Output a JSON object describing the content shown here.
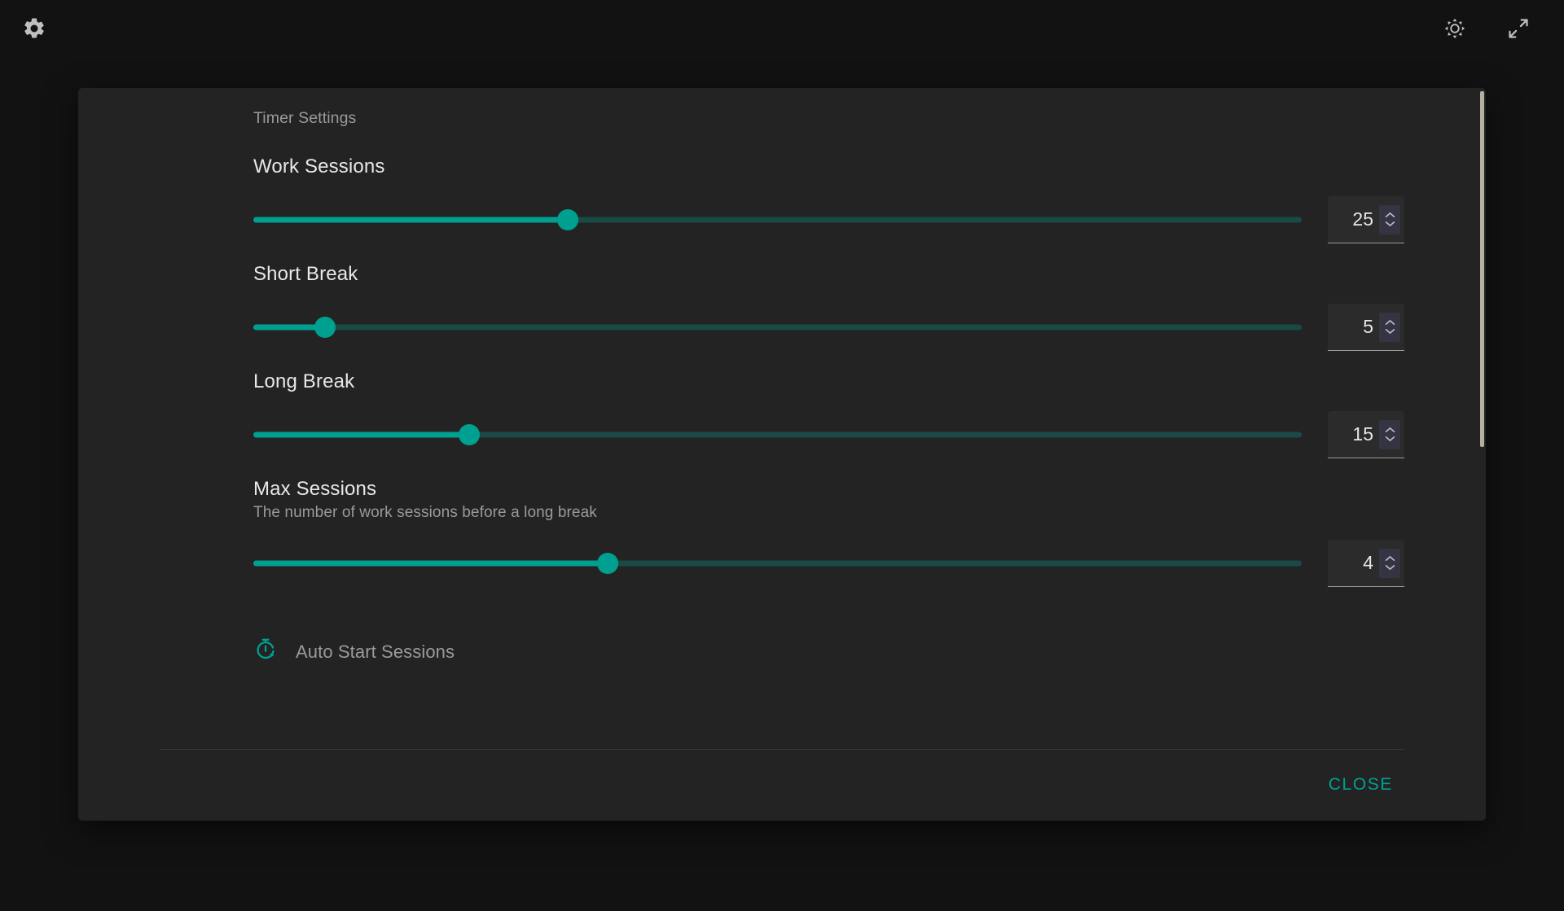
{
  "appbar": {
    "settings_icon": "gear-icon",
    "theme_icon": "brightness-icon",
    "fullscreen_icon": "fullscreen-expand-icon"
  },
  "colors": {
    "accent": "#00a090",
    "accent_rail": "#1a4a45",
    "page_bg": "#121212",
    "dialog_bg": "#232323",
    "text_primary": "#e8e8e8",
    "text_secondary": "#9a9a9a",
    "scrollbar_thumb": "#b5aea3"
  },
  "dialog": {
    "section_title": "Timer Settings",
    "settings": [
      {
        "label": "Work Sessions",
        "description": "",
        "value": "25",
        "fill_percent": 30,
        "icon": "slider-thumb-icon"
      },
      {
        "label": "Short Break",
        "description": "",
        "value": "5",
        "fill_percent": 6.8,
        "icon": "slider-thumb-icon"
      },
      {
        "label": "Long Break",
        "description": "",
        "value": "15",
        "fill_percent": 20.6,
        "icon": "slider-thumb-icon"
      },
      {
        "label": "Max Sessions",
        "description": "The number of work sessions before a long break",
        "value": "4",
        "fill_percent": 33.8,
        "icon": "slider-thumb-icon"
      }
    ],
    "toggle": {
      "label": "Auto Start Sessions",
      "icon": "stopwatch-play-icon",
      "state": "off"
    },
    "footer": {
      "close_label": "CLOSE"
    }
  }
}
